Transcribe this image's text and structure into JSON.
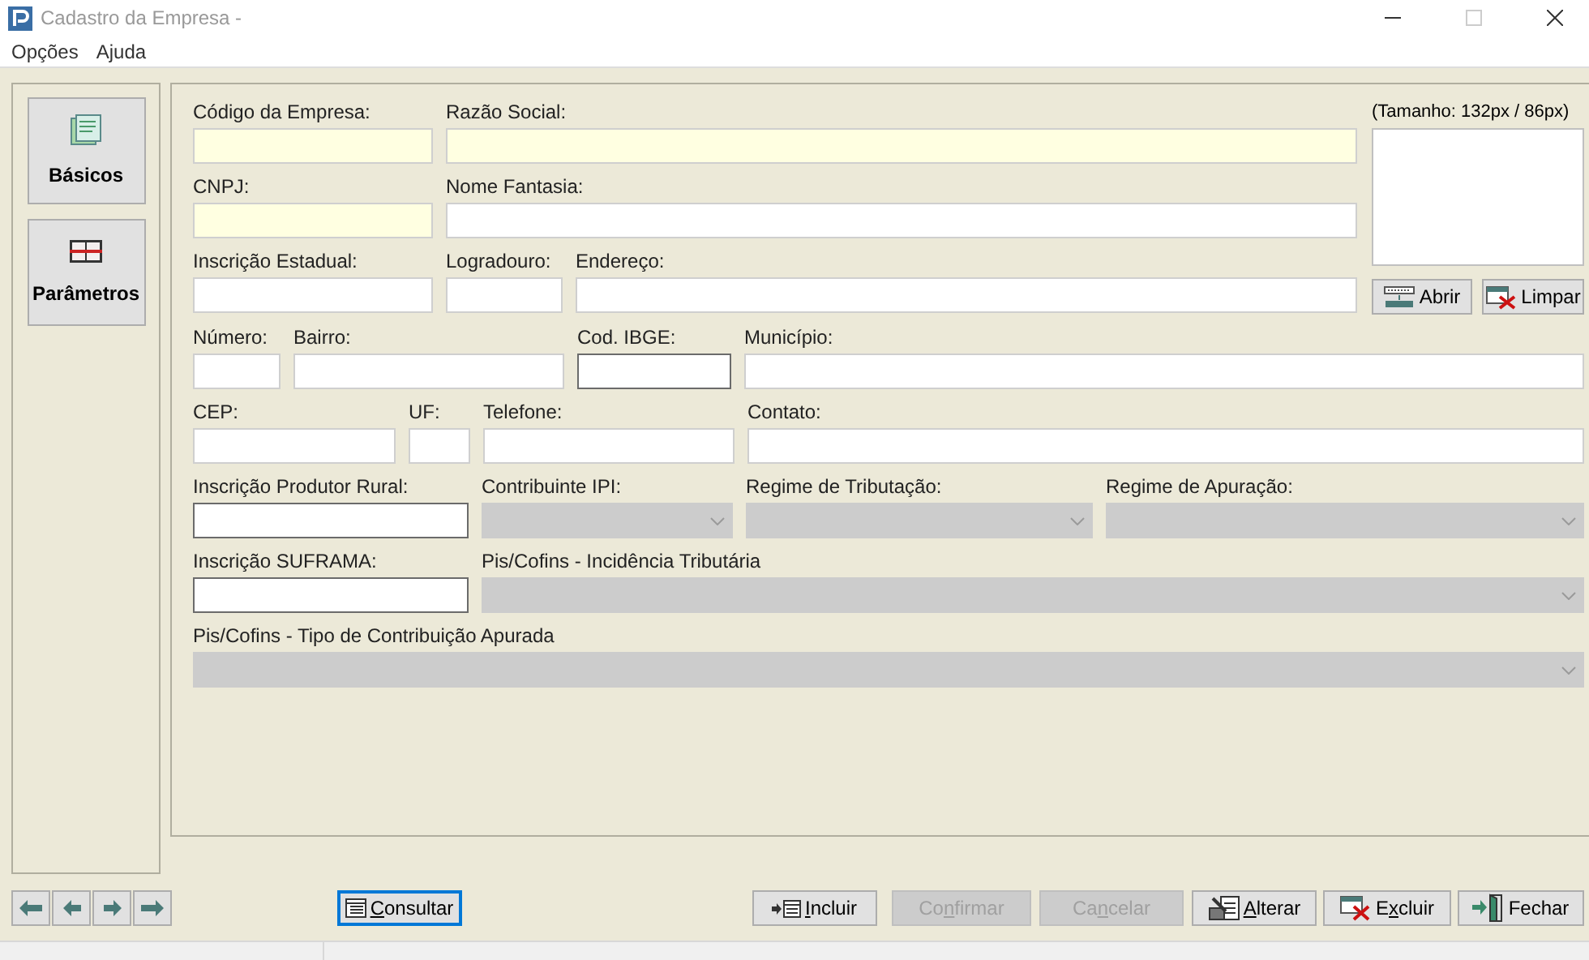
{
  "window": {
    "title": "Cadastro da Empresa -"
  },
  "menu": [
    "Opções",
    "Ajuda"
  ],
  "sidebar": {
    "items": [
      {
        "label": "Básicos"
      },
      {
        "label": "Parâmetros"
      }
    ]
  },
  "form": {
    "lines": [
      {
        "fields": [
          {
            "label": "Código da Empresa:",
            "kind": "text",
            "highlighted": true,
            "outlined": false
          },
          {
            "label": "Razão Social:",
            "kind": "text",
            "highlighted": true,
            "outlined": false
          }
        ]
      },
      {
        "fields": [
          {
            "label": "CNPJ:",
            "kind": "text",
            "highlighted": true,
            "outlined": false
          },
          {
            "label": "Nome Fantasia:",
            "kind": "text",
            "highlighted": false,
            "outlined": false
          }
        ]
      },
      {
        "fields": [
          {
            "label": "Inscrição Estadual:",
            "kind": "text",
            "highlighted": false,
            "outlined": false
          },
          {
            "label": "Logradouro:",
            "kind": "text",
            "highlighted": false,
            "outlined": false
          },
          {
            "label": "Endereço:",
            "kind": "text",
            "highlighted": false,
            "outlined": false
          }
        ]
      },
      {
        "fields": [
          {
            "label": "Número:",
            "kind": "text",
            "highlighted": false,
            "outlined": false
          },
          {
            "label": "Bairro:",
            "kind": "text",
            "highlighted": false,
            "outlined": false
          },
          {
            "label": "Cod. IBGE:",
            "kind": "text",
            "highlighted": false,
            "outlined": true
          },
          {
            "label": "Município:",
            "kind": "text",
            "highlighted": false,
            "outlined": false
          }
        ]
      },
      {
        "fields": [
          {
            "label": "CEP:",
            "kind": "text",
            "highlighted": false,
            "outlined": false
          },
          {
            "label": "UF:",
            "kind": "text",
            "highlighted": false,
            "outlined": false
          },
          {
            "label": "Telefone:",
            "kind": "text",
            "highlighted": false,
            "outlined": false
          },
          {
            "label": "Contato:",
            "kind": "text",
            "highlighted": false,
            "outlined": false
          }
        ]
      },
      {
        "fields": [
          {
            "label": "Inscrição Produtor Rural:",
            "kind": "text",
            "highlighted": false,
            "outlined": true
          },
          {
            "label": "Contribuinte IPI:",
            "kind": "select",
            "disabled": true
          },
          {
            "label": "Regime de Tributação:",
            "kind": "select",
            "disabled": true
          },
          {
            "label": "Regime de Apuração:",
            "kind": "select",
            "disabled": true
          }
        ]
      },
      {
        "fields": [
          {
            "label": "Inscrição SUFRAMA:",
            "kind": "text",
            "highlighted": false,
            "outlined": true
          },
          {
            "label": "Pis/Cofins - Incidência Tributária",
            "kind": "select",
            "disabled": true
          }
        ]
      },
      {
        "fields": [
          {
            "label": "Pis/Cofins - Tipo de Contribuição Apurada",
            "kind": "select",
            "disabled": true
          }
        ]
      }
    ]
  },
  "logo": {
    "caption": "(Tamanho: 132px / 86px)",
    "buttons": [
      "Abrir",
      "Limpar"
    ]
  },
  "actions": [
    {
      "parts": [
        {
          "text": "C",
          "underlined": true
        },
        {
          "text": "onsultar",
          "underlined": false
        }
      ],
      "focused": true,
      "disabled": false
    },
    {
      "parts": [
        {
          "text": "I",
          "underlined": true
        },
        {
          "text": "ncluir",
          "underlined": false
        }
      ],
      "focused": false,
      "disabled": false
    },
    {
      "parts": [
        {
          "text": "Co",
          "underlined": false
        },
        {
          "text": "n",
          "underlined": true
        },
        {
          "text": "firmar",
          "underlined": false
        }
      ],
      "focused": false,
      "disabled": true
    },
    {
      "parts": [
        {
          "text": "Ca",
          "underlined": false
        },
        {
          "text": "n",
          "underlined": true
        },
        {
          "text": "celar",
          "underlined": false
        }
      ],
      "focused": false,
      "disabled": true
    },
    {
      "parts": [
        {
          "text": "A",
          "underlined": true
        },
        {
          "text": "lterar",
          "underlined": false
        }
      ],
      "focused": false,
      "disabled": false
    },
    {
      "parts": [
        {
          "text": "E",
          "underlined": false
        },
        {
          "text": "x",
          "underlined": true
        },
        {
          "text": "cluir",
          "underlined": false
        }
      ],
      "focused": false,
      "disabled": false
    },
    {
      "parts": [
        {
          "text": "Fechar",
          "underlined": false
        }
      ],
      "focused": false,
      "disabled": false
    }
  ]
}
